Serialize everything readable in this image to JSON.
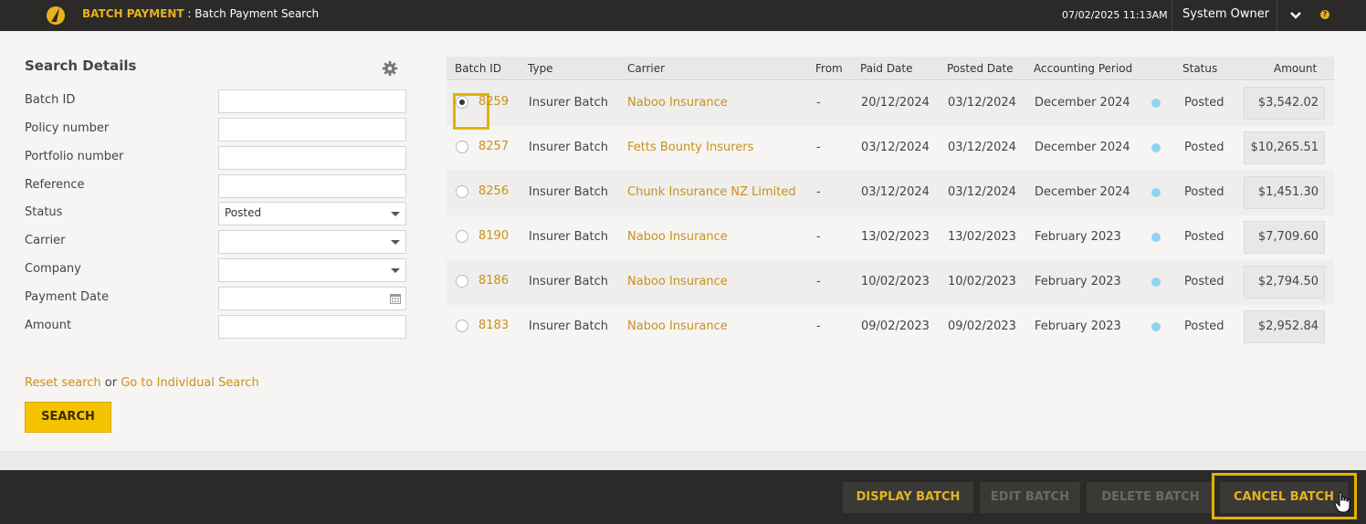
{
  "header": {
    "module": "BATCH PAYMENT",
    "separator": " : ",
    "page": "Batch Payment Search",
    "datetime": "07/02/2025 11:13AM",
    "user": "System Owner",
    "help_glyph": "?",
    "icons": [
      "logo-icon",
      "chevron-down-icon",
      "help-icon"
    ]
  },
  "search": {
    "title": "Search Details",
    "fields": {
      "batch_id": {
        "label": "Batch ID",
        "value": ""
      },
      "policy_number": {
        "label": "Policy number",
        "value": ""
      },
      "portfolio_number": {
        "label": "Portfolio number",
        "value": ""
      },
      "reference": {
        "label": "Reference",
        "value": ""
      },
      "status": {
        "label": "Status",
        "value": "Posted"
      },
      "carrier": {
        "label": "Carrier",
        "value": ""
      },
      "company": {
        "label": "Company",
        "value": ""
      },
      "payment_date": {
        "label": "Payment Date",
        "value": ""
      },
      "amount": {
        "label": "Amount",
        "value": ""
      }
    },
    "reset_link": "Reset search",
    "or_text": "or",
    "individual_link": "Go to Individual Search",
    "search_button": "SEARCH"
  },
  "table": {
    "columns": [
      "Batch ID",
      "Type",
      "Carrier",
      "From",
      "Paid Date",
      "Posted Date",
      "Accounting Period",
      "Status",
      "Amount"
    ],
    "selected_row": 0,
    "rows": [
      {
        "id": "8259",
        "type": "Insurer Batch",
        "carrier": "Naboo Insurance",
        "from": "-",
        "paid": "20/12/2024",
        "posted": "03/12/2024",
        "period": "December 2024",
        "status": "Posted",
        "amount": "$3,542.02"
      },
      {
        "id": "8257",
        "type": "Insurer Batch",
        "carrier": "Fetts Bounty Insurers",
        "from": "-",
        "paid": "03/12/2024",
        "posted": "03/12/2024",
        "period": "December 2024",
        "status": "Posted",
        "amount": "$10,265.51"
      },
      {
        "id": "8256",
        "type": "Insurer Batch",
        "carrier": "Chunk Insurance NZ Limited",
        "from": "-",
        "paid": "03/12/2024",
        "posted": "03/12/2024",
        "period": "December 2024",
        "status": "Posted",
        "amount": "$1,451.30"
      },
      {
        "id": "8190",
        "type": "Insurer Batch",
        "carrier": "Naboo Insurance",
        "from": "-",
        "paid": "13/02/2023",
        "posted": "13/02/2023",
        "period": "February 2023",
        "status": "Posted",
        "amount": "$7,709.60"
      },
      {
        "id": "8186",
        "type": "Insurer Batch",
        "carrier": "Naboo Insurance",
        "from": "-",
        "paid": "10/02/2023",
        "posted": "10/02/2023",
        "period": "February 2023",
        "status": "Posted",
        "amount": "$2,794.50"
      },
      {
        "id": "8183",
        "type": "Insurer Batch",
        "carrier": "Naboo Insurance",
        "from": "-",
        "paid": "09/02/2023",
        "posted": "09/02/2023",
        "period": "February 2023",
        "status": "Posted",
        "amount": "$2,952.84"
      }
    ]
  },
  "actions": {
    "display": "DISPLAY BATCH",
    "edit": "EDIT BATCH",
    "delete": "DELETE BATCH",
    "cancel": "CANCEL BATCH"
  },
  "colors": {
    "accent": "#e8b21c",
    "link": "#c9901a",
    "topbar": "#2b2a29",
    "search_button": "#f5c400",
    "status_dot": "#8fd3f4"
  }
}
